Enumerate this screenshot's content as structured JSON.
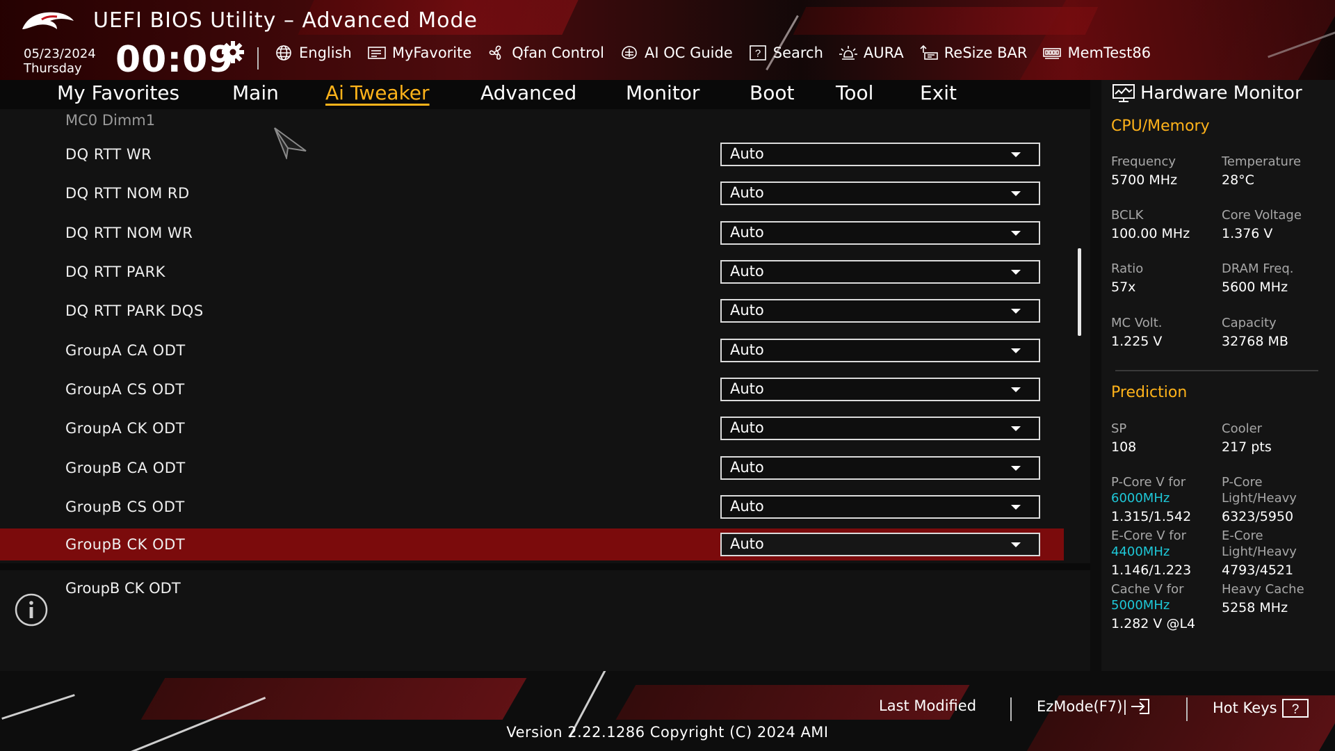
{
  "header": {
    "title": "UEFI BIOS Utility – Advanced Mode",
    "date": "05/23/2024",
    "weekday": "Thursday",
    "time": "00:09",
    "toolbar": [
      {
        "label": "English",
        "icon": "globe-icon"
      },
      {
        "label": "MyFavorite",
        "icon": "favorite-icon"
      },
      {
        "label": "Qfan Control",
        "icon": "fan-icon"
      },
      {
        "label": "AI OC Guide",
        "icon": "ai-oc-guide-icon"
      },
      {
        "label": "Search",
        "icon": "search-icon"
      },
      {
        "label": "AURA",
        "icon": "aura-icon"
      },
      {
        "label": "ReSize BAR",
        "icon": "resize-bar-icon"
      },
      {
        "label": "MemTest86",
        "icon": "memtest-icon"
      }
    ]
  },
  "nav": {
    "tabs": [
      "My Favorites",
      "Main",
      "Ai Tweaker",
      "Advanced",
      "Monitor",
      "Boot",
      "Tool",
      "Exit"
    ],
    "active": "Ai Tweaker"
  },
  "settings": {
    "section": "MC0 Dimm1",
    "rows": [
      {
        "label": "DQ RTT WR",
        "value": "Auto"
      },
      {
        "label": "DQ RTT NOM RD",
        "value": "Auto"
      },
      {
        "label": "DQ RTT NOM WR",
        "value": "Auto"
      },
      {
        "label": "DQ RTT PARK",
        "value": "Auto"
      },
      {
        "label": "DQ RTT PARK DQS",
        "value": "Auto"
      },
      {
        "label": "GroupA CA ODT",
        "value": "Auto"
      },
      {
        "label": "GroupA CS ODT",
        "value": "Auto"
      },
      {
        "label": "GroupA CK ODT",
        "value": "Auto"
      },
      {
        "label": "GroupB CA ODT",
        "value": "Auto"
      },
      {
        "label": "GroupB CS ODT",
        "value": "Auto"
      },
      {
        "label": "GroupB CK ODT",
        "value": "Auto"
      }
    ],
    "selected_index": 10
  },
  "help": {
    "text": "GroupB CK ODT"
  },
  "hardware_monitor": {
    "title": "Hardware Monitor",
    "cpu_memory": {
      "heading": "CPU/Memory",
      "frequency_label": "Frequency",
      "frequency": "5700 MHz",
      "temperature_label": "Temperature",
      "temperature": "28°C",
      "bclk_label": "BCLK",
      "bclk": "100.00 MHz",
      "core_voltage_label": "Core Voltage",
      "core_voltage": "1.376 V",
      "ratio_label": "Ratio",
      "ratio": "57x",
      "dram_freq_label": "DRAM Freq.",
      "dram_freq": "5600 MHz",
      "mc_volt_label": "MC Volt.",
      "mc_volt": "1.225 V",
      "capacity_label": "Capacity",
      "capacity": "32768 MB"
    },
    "prediction": {
      "heading": "Prediction",
      "sp_label": "SP",
      "sp": "108",
      "cooler_label": "Cooler",
      "cooler": "217 pts",
      "pcore_v_label": "P-Core V for",
      "pcore_v_freq": "6000MHz",
      "pcore_v": "1.315/1.542",
      "pcore_lh_label1": "P-Core",
      "pcore_lh_label2": "Light/Heavy",
      "pcore_lh": "6323/5950",
      "ecore_v_label": "E-Core V for",
      "ecore_v_freq": "4400MHz",
      "ecore_v": "1.146/1.223",
      "ecore_lh_label1": "E-Core",
      "ecore_lh_label2": "Light/Heavy",
      "ecore_lh": "4793/4521",
      "cache_v_label": "Cache V for",
      "cache_v_freq": "5000MHz",
      "cache_v": "1.282 V @L4",
      "heavy_cache_label": "Heavy Cache",
      "heavy_cache": "5258 MHz"
    }
  },
  "footer": {
    "last_modified": "Last Modified",
    "ezmode": "EzMode(F7)|",
    "hot_keys": "Hot Keys",
    "version": "Version 2.22.1286 Copyright (C) 2024 AMI"
  },
  "colors": {
    "accent": "#ffb31a",
    "highlight": "#1ec8d8",
    "selected_row": "#7b0b0c",
    "brand_red": "#a4151b"
  }
}
